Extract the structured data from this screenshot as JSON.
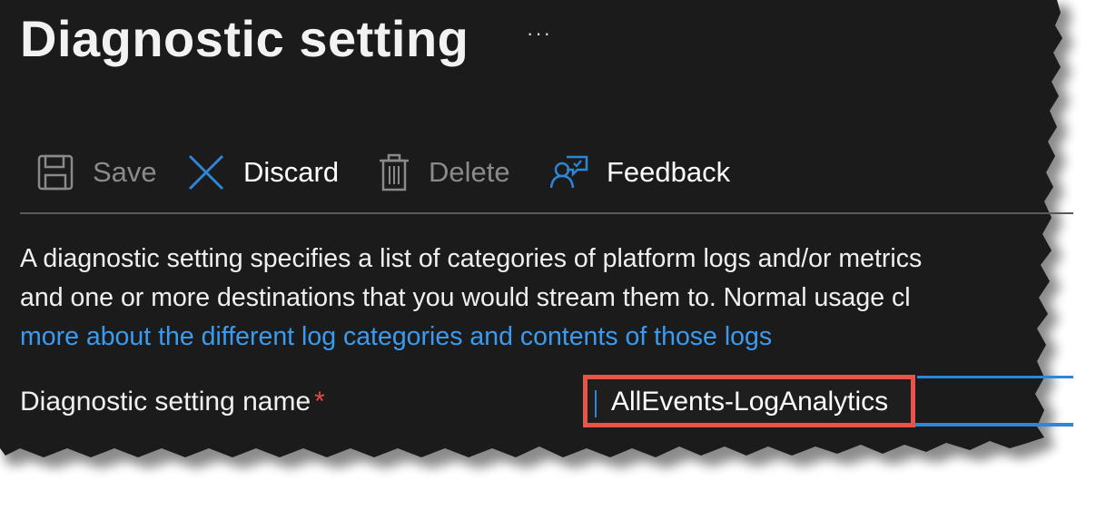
{
  "page": {
    "title": "Diagnostic setting",
    "more_icon": "ellipsis-icon"
  },
  "toolbar": {
    "save": {
      "label": "Save",
      "icon": "save-icon",
      "enabled": false
    },
    "discard": {
      "label": "Discard",
      "icon": "close-icon",
      "enabled": true
    },
    "delete": {
      "label": "Delete",
      "icon": "trash-icon",
      "enabled": false
    },
    "feedback": {
      "label": "Feedback",
      "icon": "feedback-icon",
      "enabled": true
    }
  },
  "description": {
    "line1": "A diagnostic setting specifies a list of categories of platform logs and/or metrics",
    "line2": "and one or more destinations that you would stream them to. Normal usage cl",
    "link": "more about the different log categories and contents of those logs"
  },
  "form": {
    "name_label": "Diagnostic setting name",
    "required_marker": "*",
    "name_value": "AllEvents-LogAnalytics"
  },
  "colors": {
    "background": "#1b1b1b",
    "link": "#3a9bf0",
    "accent": "#2f86d6",
    "highlight": "#e8534a",
    "required": "#e04a4a"
  }
}
